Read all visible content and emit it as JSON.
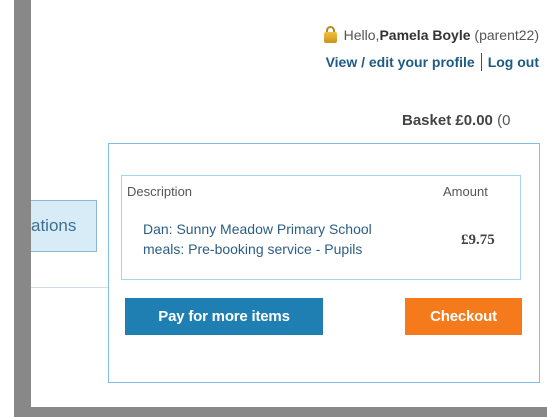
{
  "header": {
    "greeting_prefix": "Hello, ",
    "user_name": "Pamela Boyle",
    "username": "(parent22)",
    "profile_link": "View / edit your profile",
    "logout_link": "Log out"
  },
  "basket": {
    "label": "Basket £0.00",
    "count_fragment": "(0"
  },
  "nav": {
    "tab_fragment": "ations"
  },
  "basket_panel": {
    "col_description": "Description",
    "col_amount": "Amount",
    "items": [
      {
        "description_line1": "Dan: Sunny Meadow Primary School",
        "description_line2": "meals: Pre-booking service - Pupils",
        "amount": "£9.75"
      }
    ],
    "pay_more_label": "Pay for more items",
    "checkout_label": "Checkout"
  },
  "colors": {
    "primary_button": "#1f7fb3",
    "checkout_button": "#f47a1c",
    "link": "#1d5b85",
    "panel_border": "#7fbfe6"
  },
  "icons": {
    "user_icon": "padlock-icon"
  }
}
